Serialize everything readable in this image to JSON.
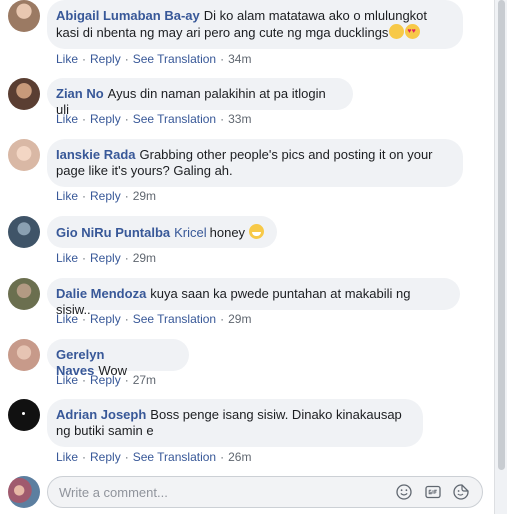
{
  "comments": [
    {
      "author": "Abigail Lumaban Ba-ay",
      "mention": "",
      "text": "Di ko alam matatawa ako o mlulungkot kasi di nbenta ng may ari pero ang cute ng mga ducklings",
      "like": "Like",
      "reply": "Reply",
      "translate": "See Translation",
      "time": "34m",
      "avatar_color": "#9b7a63"
    },
    {
      "author": "Zian No",
      "mention": "",
      "text": "Ayus din naman palakihin at pa itlogin uli",
      "like": "Like",
      "reply": "Reply",
      "translate": "See Translation",
      "time": "33m",
      "avatar_color": "#7a5a48"
    },
    {
      "author": "Ianskie Rada",
      "mention": "",
      "text": "Grabbing other people's pics and posting it on your page like it's yours? Galing ah.",
      "like": "Like",
      "reply": "Reply",
      "translate": "",
      "time": "29m",
      "avatar_color": "#d9b8a5"
    },
    {
      "author": "Gio NiRu Puntalba",
      "mention": "Kricel",
      "text": "honey",
      "like": "Like",
      "reply": "Reply",
      "translate": "",
      "time": "29m",
      "avatar_color": "#3f5468"
    },
    {
      "author": "Dalie Mendoza",
      "mention": "",
      "text": "kuya saan ka pwede puntahan at makabili ng sisiw..",
      "like": "Like",
      "reply": "Reply",
      "translate": "See Translation",
      "time": "29m",
      "avatar_color": "#6b6f4f"
    },
    {
      "author": "Gerelyn Naves",
      "mention": "",
      "text": "Wow",
      "like": "Like",
      "reply": "Reply",
      "translate": "",
      "time": "27m",
      "avatar_color": "#c79a8a"
    },
    {
      "author": "Adrian Joseph",
      "mention": "",
      "text": "Boss penge isang sisiw. Dinako kinakausap ng butiki samin e",
      "like": "Like",
      "reply": "Reply",
      "translate": "See Translation",
      "time": "26m",
      "avatar_color": "#111111"
    }
  ],
  "composer": {
    "placeholder": "Write a comment...",
    "avatar_color": "#a05a6e"
  },
  "icons": [
    "smiley-icon",
    "gif-icon",
    "sticker-icon"
  ]
}
